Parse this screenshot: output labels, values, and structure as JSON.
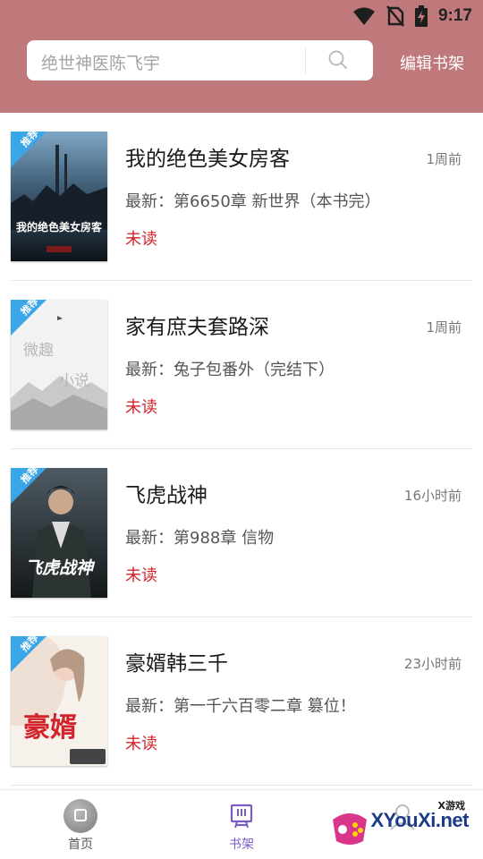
{
  "status_bar": {
    "time": "9:17",
    "icons": [
      "wifi-icon",
      "no-sim-icon",
      "battery-charging-icon"
    ]
  },
  "search": {
    "text": "绝世神医陈飞宇",
    "icon": "search-icon"
  },
  "header": {
    "edit_shelf_label": "编辑书架"
  },
  "colors": {
    "header_bg": "#c0797b",
    "unread": "#d2232a",
    "tag_blue": "#3aa6e8",
    "nav_active": "#7b5cc4"
  },
  "books": [
    {
      "title": "我的绝色美女房客",
      "time": "1周前",
      "latest": "最新：第6650章 新世界（本书完）",
      "status": "未读",
      "tag": "推荐",
      "cover_text": "我的绝色美女房客"
    },
    {
      "title": "家有庶夫套路深",
      "time": "1周前",
      "latest": "最新：兔子包番外（完结下）",
      "status": "未读",
      "tag": "推荐",
      "cover_text_a": "微趣",
      "cover_text_b": "小说"
    },
    {
      "title": "飞虎战神",
      "time": "16小时前",
      "latest": "最新：第988章 信物",
      "status": "未读",
      "tag": "推荐",
      "cover_text": "飞虎战神"
    },
    {
      "title": "豪婿韩三千",
      "time": "23小时前",
      "latest": "最新：第一千六百零二章 篡位！",
      "status": "未读",
      "tag": "推荐",
      "cover_text": "豪婿"
    }
  ],
  "bottom_nav": {
    "home_label": "首页",
    "shelf_label": "书架"
  },
  "watermark": {
    "small": "X游戏",
    "text": "XYouXi.net"
  }
}
